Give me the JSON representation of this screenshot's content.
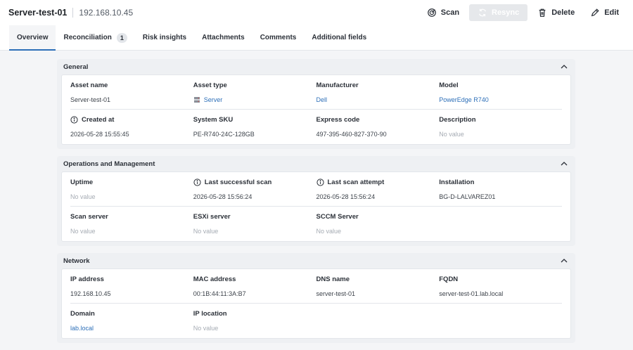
{
  "header": {
    "title": "Server-test-01",
    "ip": "192.168.10.45"
  },
  "actions": {
    "scan": "Scan",
    "resync": "Resync",
    "delete": "Delete",
    "edit": "Edit"
  },
  "tabs": [
    {
      "label": "Overview"
    },
    {
      "label": "Reconciliation",
      "badge": "1"
    },
    {
      "label": "Risk insights"
    },
    {
      "label": "Attachments"
    },
    {
      "label": "Comments"
    },
    {
      "label": "Additional fields"
    }
  ],
  "general": {
    "title": "General",
    "asset_name_label": "Asset name",
    "asset_name": "Server-test-01",
    "asset_type_label": "Asset type",
    "asset_type": "Server",
    "manufacturer_label": "Manufacturer",
    "manufacturer": "Dell",
    "model_label": "Model",
    "model": "PowerEdge R740",
    "created_at_label": "Created at",
    "created_at": "2026-05-28 15:55:45",
    "system_sku_label": "System SKU",
    "system_sku": "PE-R740-24C-128GB",
    "express_code_label": "Express code",
    "express_code": "497-395-460-827-370-90",
    "description_label": "Description",
    "description": "No value"
  },
  "operations": {
    "title": "Operations and Management",
    "uptime_label": "Uptime",
    "uptime": "No value",
    "last_scan_label": "Last successful scan",
    "last_scan": "2026-05-28 15:56:24",
    "last_attempt_label": "Last scan attempt",
    "last_attempt": "2026-05-28 15:56:24",
    "installation_label": "Installation",
    "installation": "BG-D-LALVAREZ01",
    "scan_server_label": "Scan server",
    "scan_server": "No value",
    "esxi_label": "ESXi server",
    "esxi": "No value",
    "sccm_label": "SCCM Server",
    "sccm": "No value"
  },
  "network": {
    "title": "Network",
    "ip_label": "IP address",
    "ip": "192.168.10.45",
    "mac_label": "MAC address",
    "mac": "00:1B:44:11:3A:B7",
    "dns_label": "DNS name",
    "dns": "server-test-01",
    "fqdn_label": "FQDN",
    "fqdn": "server-test-01.lab.local",
    "domain_label": "Domain",
    "domain": "lab.local",
    "ip_location_label": "IP location",
    "ip_location": "No value"
  }
}
